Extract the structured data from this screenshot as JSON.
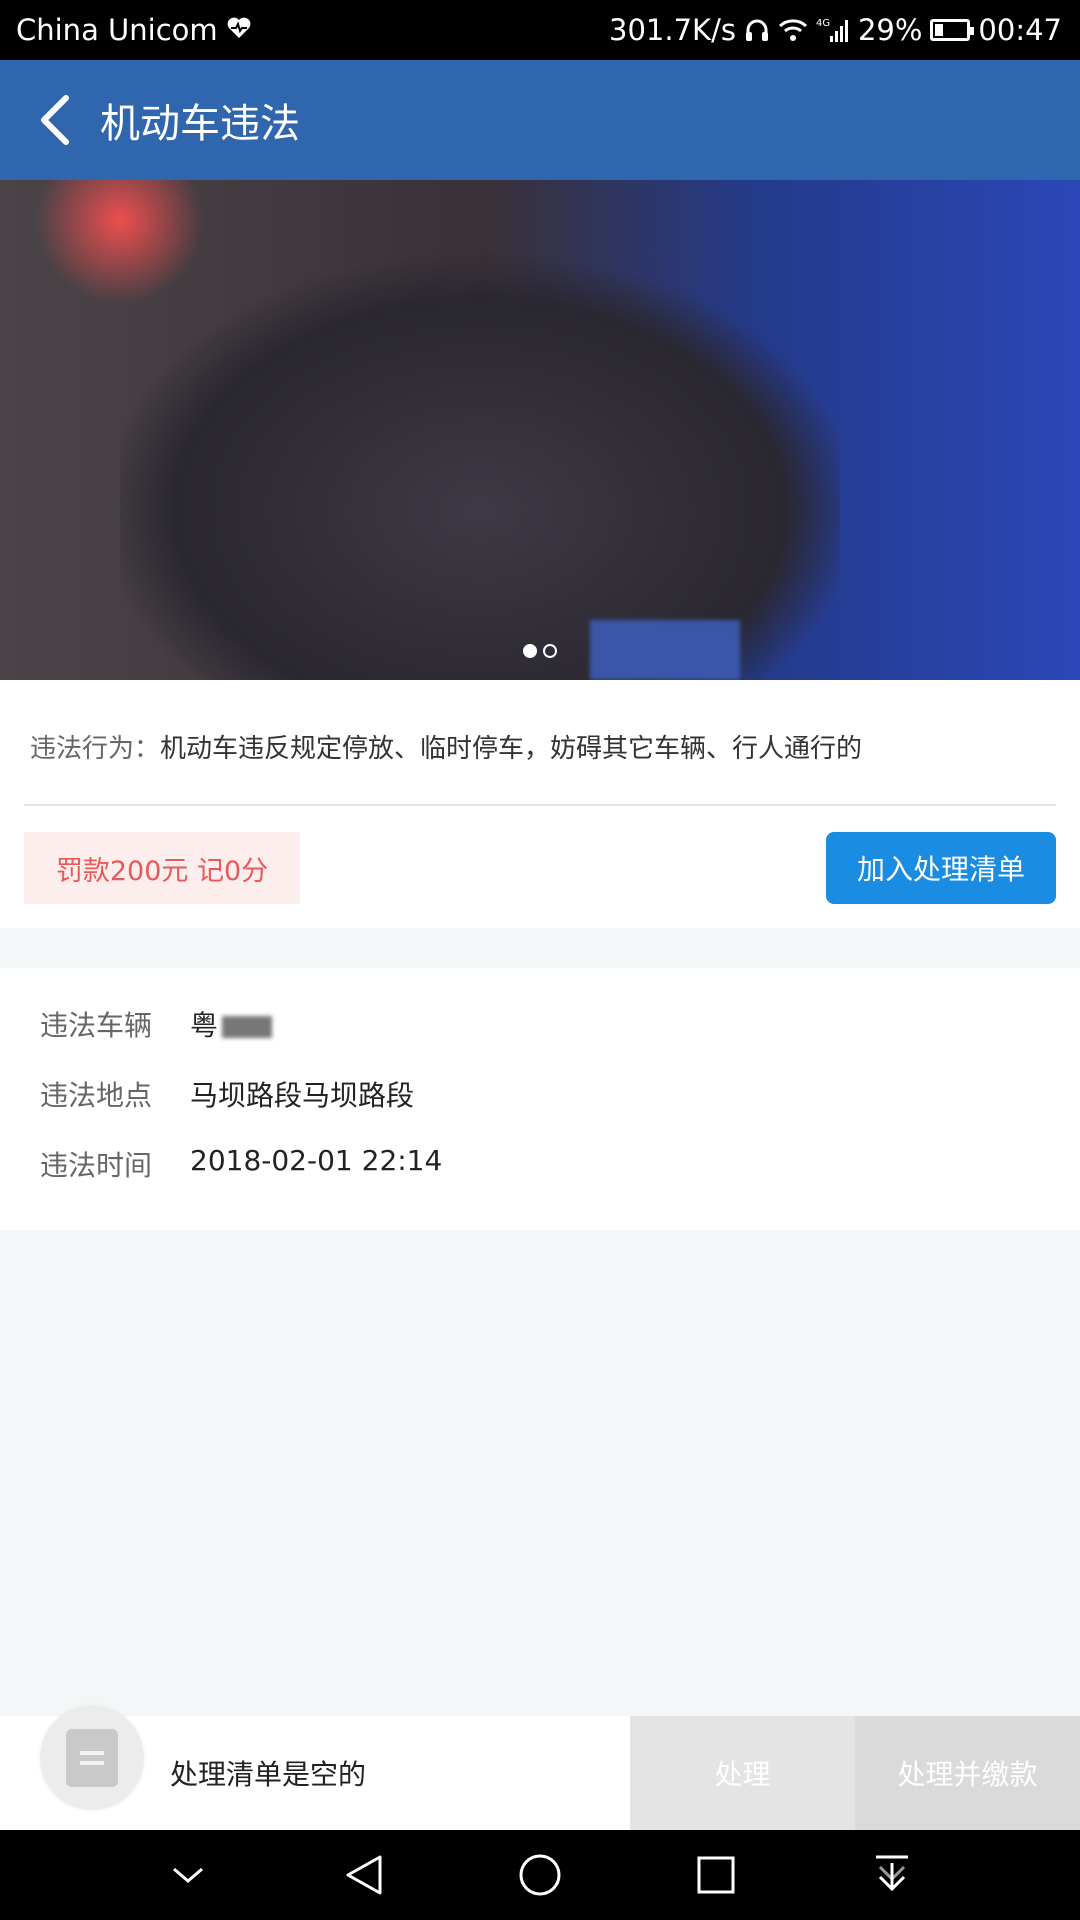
{
  "status_bar": {
    "carrier": "China Unicom",
    "network_speed": "301.7K/s",
    "network_type": "4G",
    "battery": "29%",
    "time": "00:47"
  },
  "app_bar": {
    "title": "机动车违法"
  },
  "photo": {
    "page_count": 2,
    "active_page": 1
  },
  "violation": {
    "behavior_label": "违法行为：",
    "behavior_text": "机动车违反规定停放、临时停车，妨碍其它车辆、行人通行的",
    "fine": "罚款200元 记0分",
    "add_button": "加入处理清单"
  },
  "details": {
    "vehicle_label": "违法车辆",
    "vehicle_value": "粤",
    "location_label": "违法地点",
    "location_value": "马坝路段马坝路段",
    "time_label": "违法时间",
    "time_value": "2018-02-01 22:14"
  },
  "bottom_bar": {
    "empty_text": "处理清单是空的",
    "process_label": "处理",
    "process_pay_label": "处理并缴款"
  },
  "colors": {
    "app_bar": "#2f66ad",
    "primary_button": "#1a8de3",
    "fine_text": "#e8595b",
    "fine_bg": "#fdeeee"
  },
  "icons": [
    "back-arrow-icon",
    "heart-icon",
    "headphones-icon",
    "wifi-icon",
    "signal-icon",
    "battery-icon",
    "list-icon",
    "chevron-down-icon",
    "back-triangle-icon",
    "home-circle-icon",
    "recents-square-icon",
    "download-icon"
  ]
}
